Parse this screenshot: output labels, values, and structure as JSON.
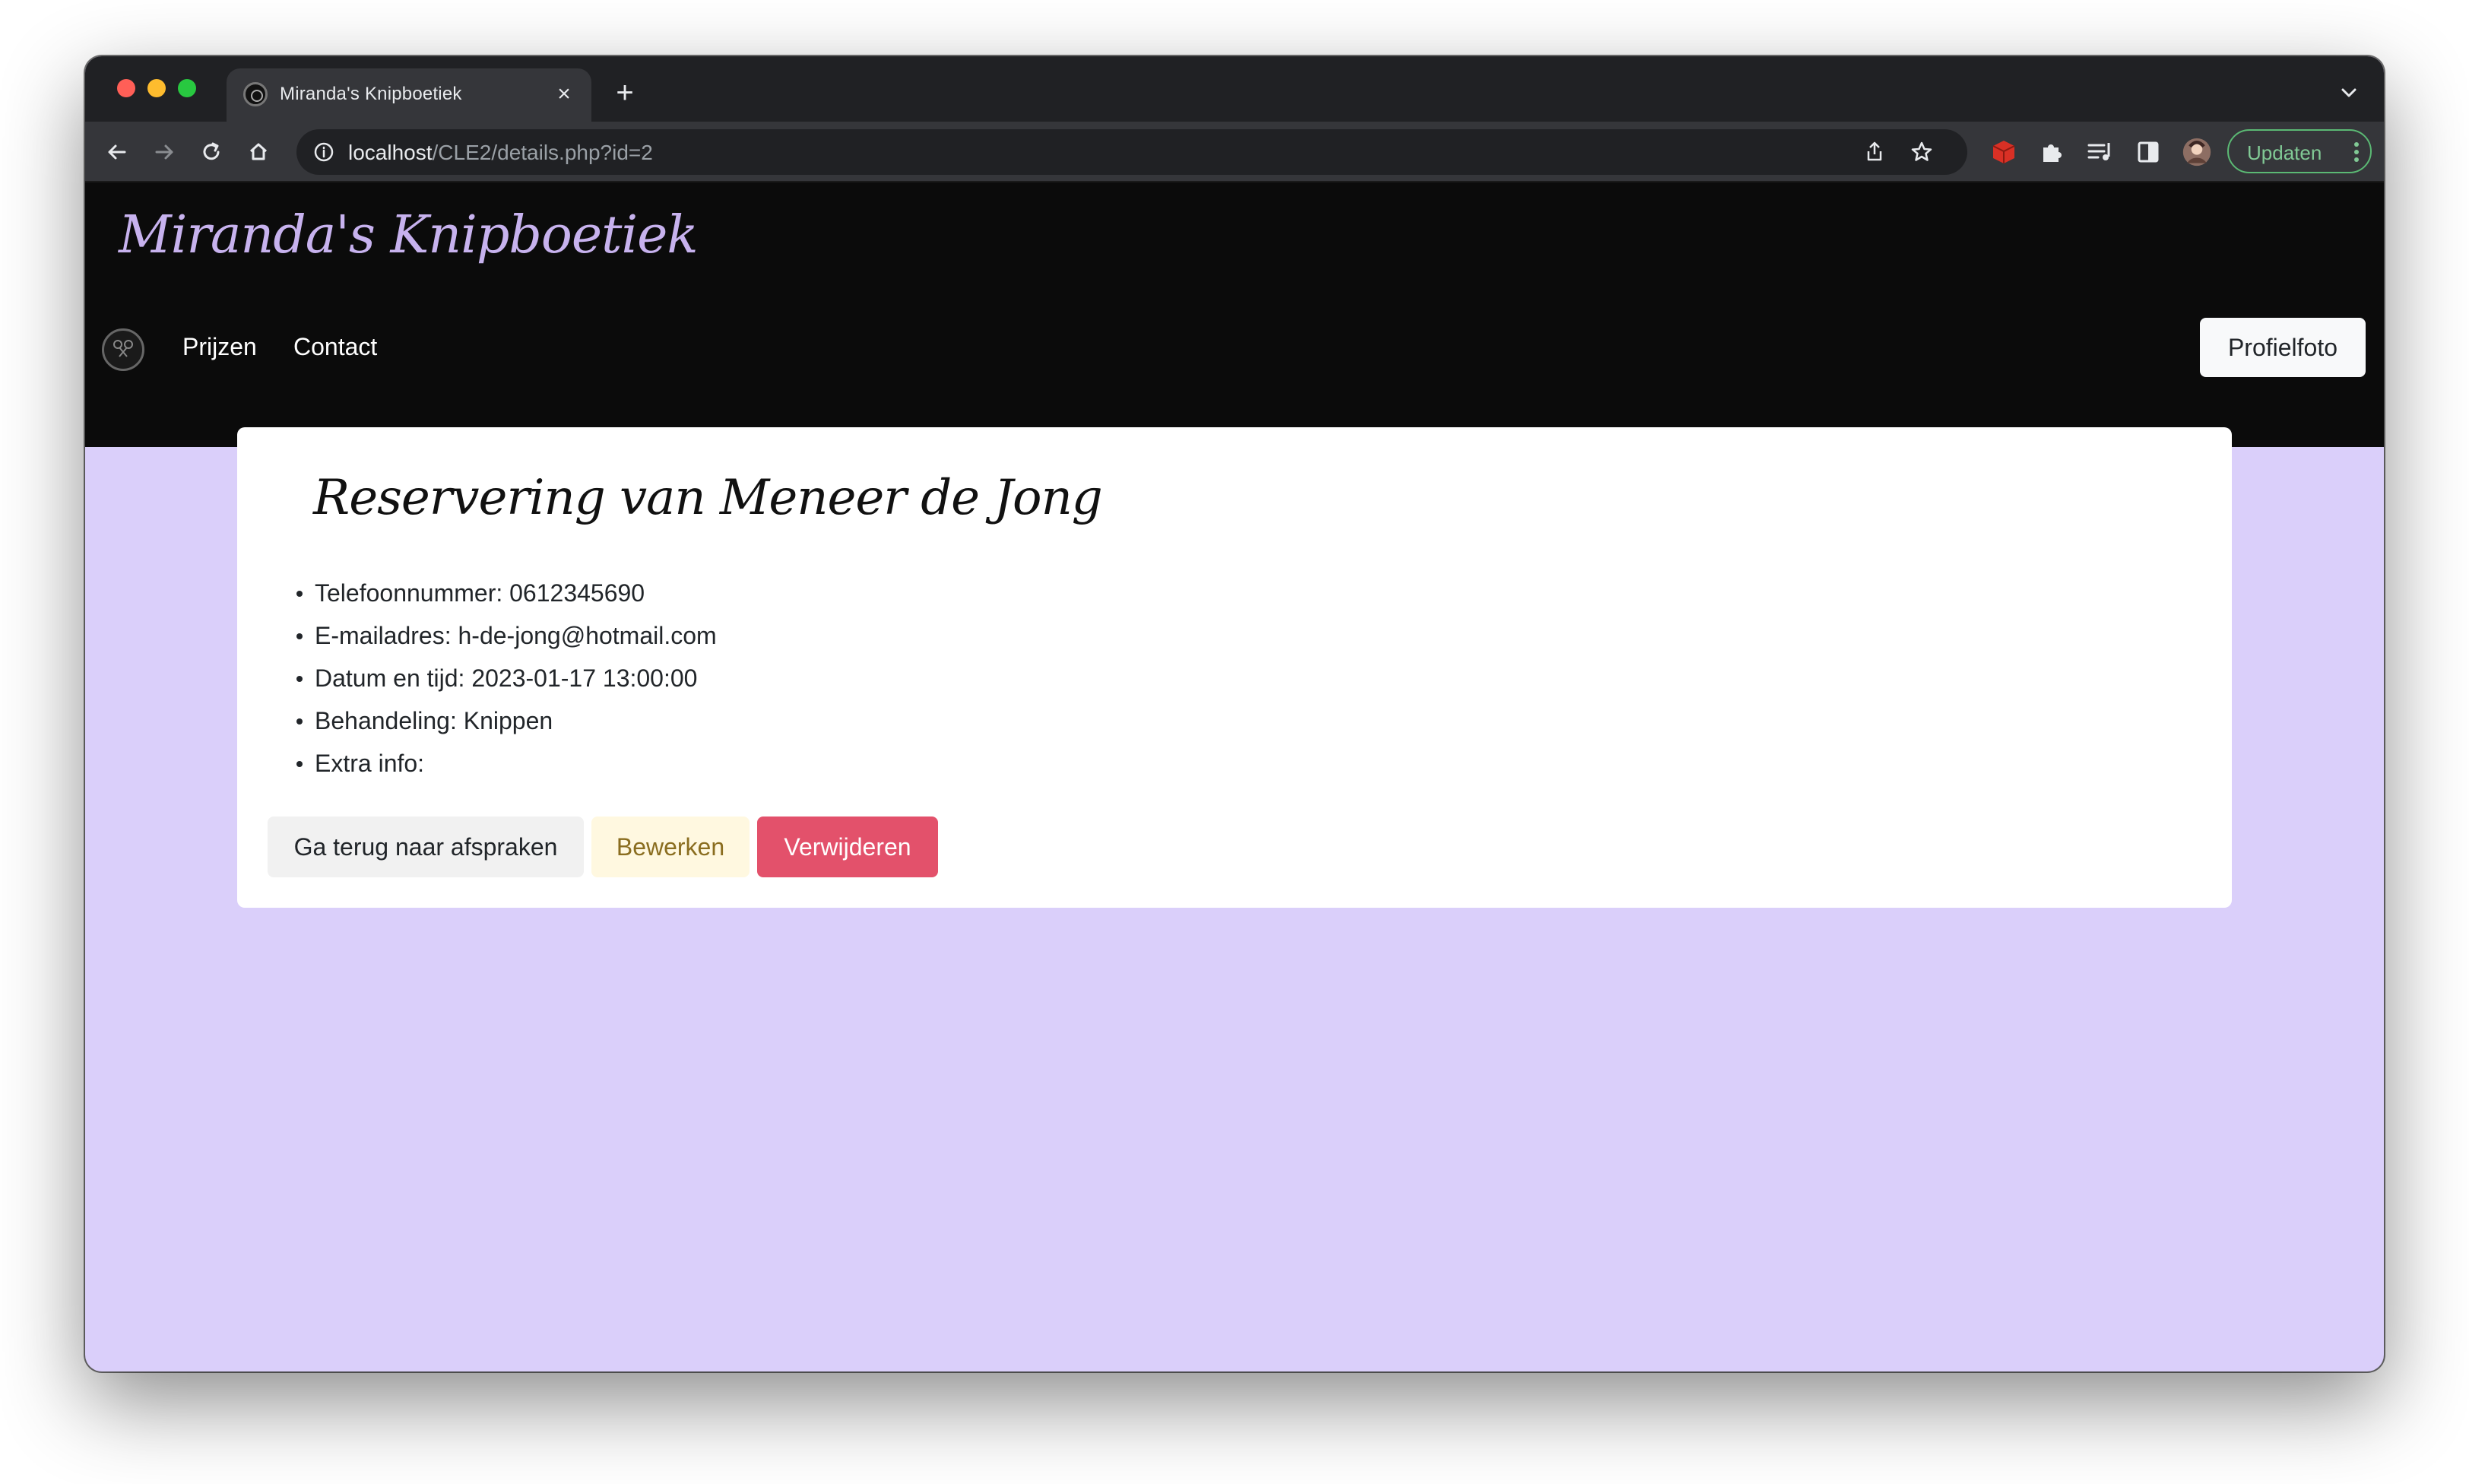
{
  "browser": {
    "tab_title": "Miranda's Knipboetiek",
    "url_host": "localhost",
    "url_path": "/CLE2/details.php?id=2",
    "update_label": "Updaten"
  },
  "site": {
    "brand": "Miranda's Knipboetiek",
    "nav": [
      "Prijzen",
      "Contact"
    ],
    "profile_button": "Profielfoto"
  },
  "reservation": {
    "title": "Reservering van Meneer de Jong",
    "details": [
      "Telefoonnummer: 0612345690",
      "E-mailadres: h-de-jong@hotmail.com",
      "Datum en tijd: 2023-01-17 13:00:00",
      "Behandeling: Knippen",
      "Extra info:"
    ],
    "buttons": {
      "back": "Ga terug naar afspraken",
      "edit": "Bewerken",
      "delete": "Verwijderen"
    }
  },
  "colors": {
    "page_background": "#dacffa",
    "brand_text": "#c7b2ee",
    "delete_button": "#e3516b",
    "edit_button": "#fff8e0"
  },
  "icons": [
    "back-icon",
    "forward-icon",
    "reload-icon",
    "home-icon",
    "info-icon",
    "share-icon",
    "bookmark-star-icon",
    "extension-cube-icon",
    "puzzle-extensions-icon",
    "media-queue-icon",
    "sidebar-icon",
    "profile-avatar-icon",
    "kebab-menu-icon",
    "tab-search-chevron-icon"
  ]
}
